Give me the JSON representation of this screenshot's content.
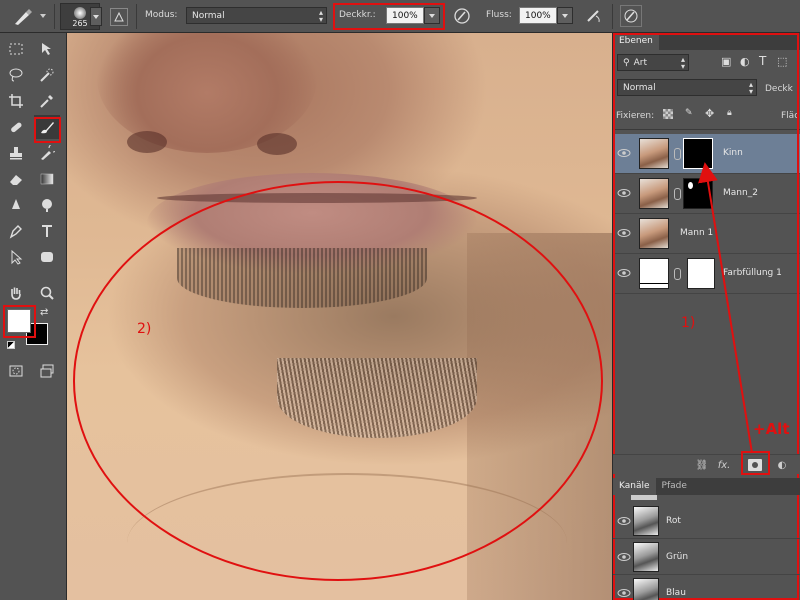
{
  "optionsbar": {
    "brush_size": "265",
    "mode_label": "Modus:",
    "mode_value": "Normal",
    "opacity_label": "Deckkr.:",
    "opacity_value": "100%",
    "flow_label": "Fluss:",
    "flow_value": "100%"
  },
  "toolbar": {
    "tools": [
      "marquee-icon",
      "move-icon",
      "lasso-icon",
      "quick-select-icon",
      "crop-icon",
      "eyedropper-icon",
      "healing-icon",
      "brush-icon",
      "stamp-icon",
      "history-brush-icon",
      "eraser-icon",
      "gradient-icon",
      "blur-icon",
      "dodge-icon",
      "pen-icon",
      "text-icon",
      "path-select-icon",
      "shape-icon",
      "hand-icon",
      "zoom-icon"
    ]
  },
  "canvas": {
    "annotation_2": "2)"
  },
  "layers_panel": {
    "tab_label": "Ebenen",
    "filter_value": "Art",
    "blend_mode": "Normal",
    "opacity_label": "Deckk",
    "lock_label": "Fixieren:",
    "fill_label": "Fläc",
    "layers": [
      {
        "name": "Kinn",
        "selected": true,
        "mask": "black"
      },
      {
        "name": "Mann_2",
        "selected": false,
        "mask": "black-white"
      },
      {
        "name": "Mann 1",
        "selected": false,
        "mask": "none"
      },
      {
        "name": "Farbfüllung 1",
        "selected": false,
        "mask": "white"
      }
    ],
    "annotation_1": "1)",
    "annotation_alt": "+Alt",
    "bottom_fx": "fx."
  },
  "channels_panel": {
    "tabs": [
      "Kanäle",
      "Pfade"
    ],
    "channels": [
      "Rot",
      "Grün",
      "Blau"
    ]
  },
  "colors": {
    "annotation_red": "#e01010",
    "selected_layer": "#6d7f96"
  }
}
